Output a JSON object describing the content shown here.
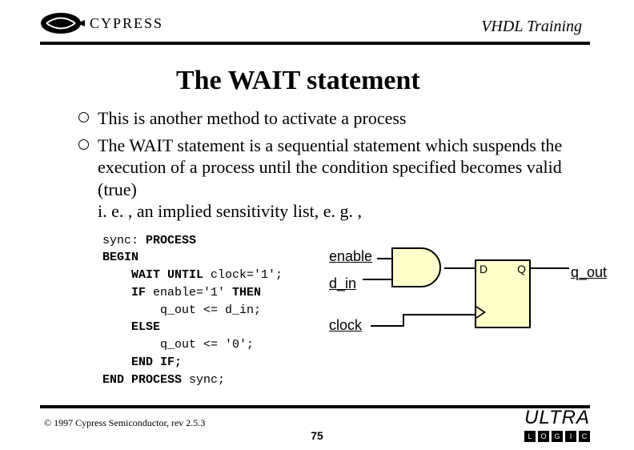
{
  "header": {
    "brand": "CYPRESS",
    "course_title": "VHDL Training"
  },
  "slide": {
    "title": "The WAIT statement",
    "bullets": [
      "This is another method to activate a process",
      "The WAIT statement is a sequential statement which suspends the execution of a process until the condition specified becomes valid (true)\ni. e. , an implied sensitivity list, e. g. ,"
    ]
  },
  "code": {
    "line1_a": "sync: ",
    "line1_b": "PROCESS",
    "line2": "BEGIN",
    "line3_a": "    WAIT UNTIL",
    "line3_b": " clock='1';",
    "line4_a": "    IF",
    "line4_b": " enable='1' ",
    "line4_c": "THEN",
    "line5": "        q_out <= d_in;",
    "line6": "    ELSE",
    "line7": "        q_out <= '0';",
    "line8": "    END IF;",
    "line9_a": "END PROCESS",
    "line9_b": " sync;"
  },
  "diagram": {
    "labels": {
      "enable": "enable",
      "d_in": "d_in",
      "clock": "clock",
      "q_out": "q_out"
    },
    "flipflop": {
      "d": "D",
      "q": "Q"
    }
  },
  "footer": {
    "copyright": "© 1997 Cypress Semiconductor, rev 2.5.3",
    "page": "75",
    "ultra": "ULTRA",
    "ultra_tag": [
      "L",
      "O",
      "G",
      "I",
      "C"
    ]
  }
}
